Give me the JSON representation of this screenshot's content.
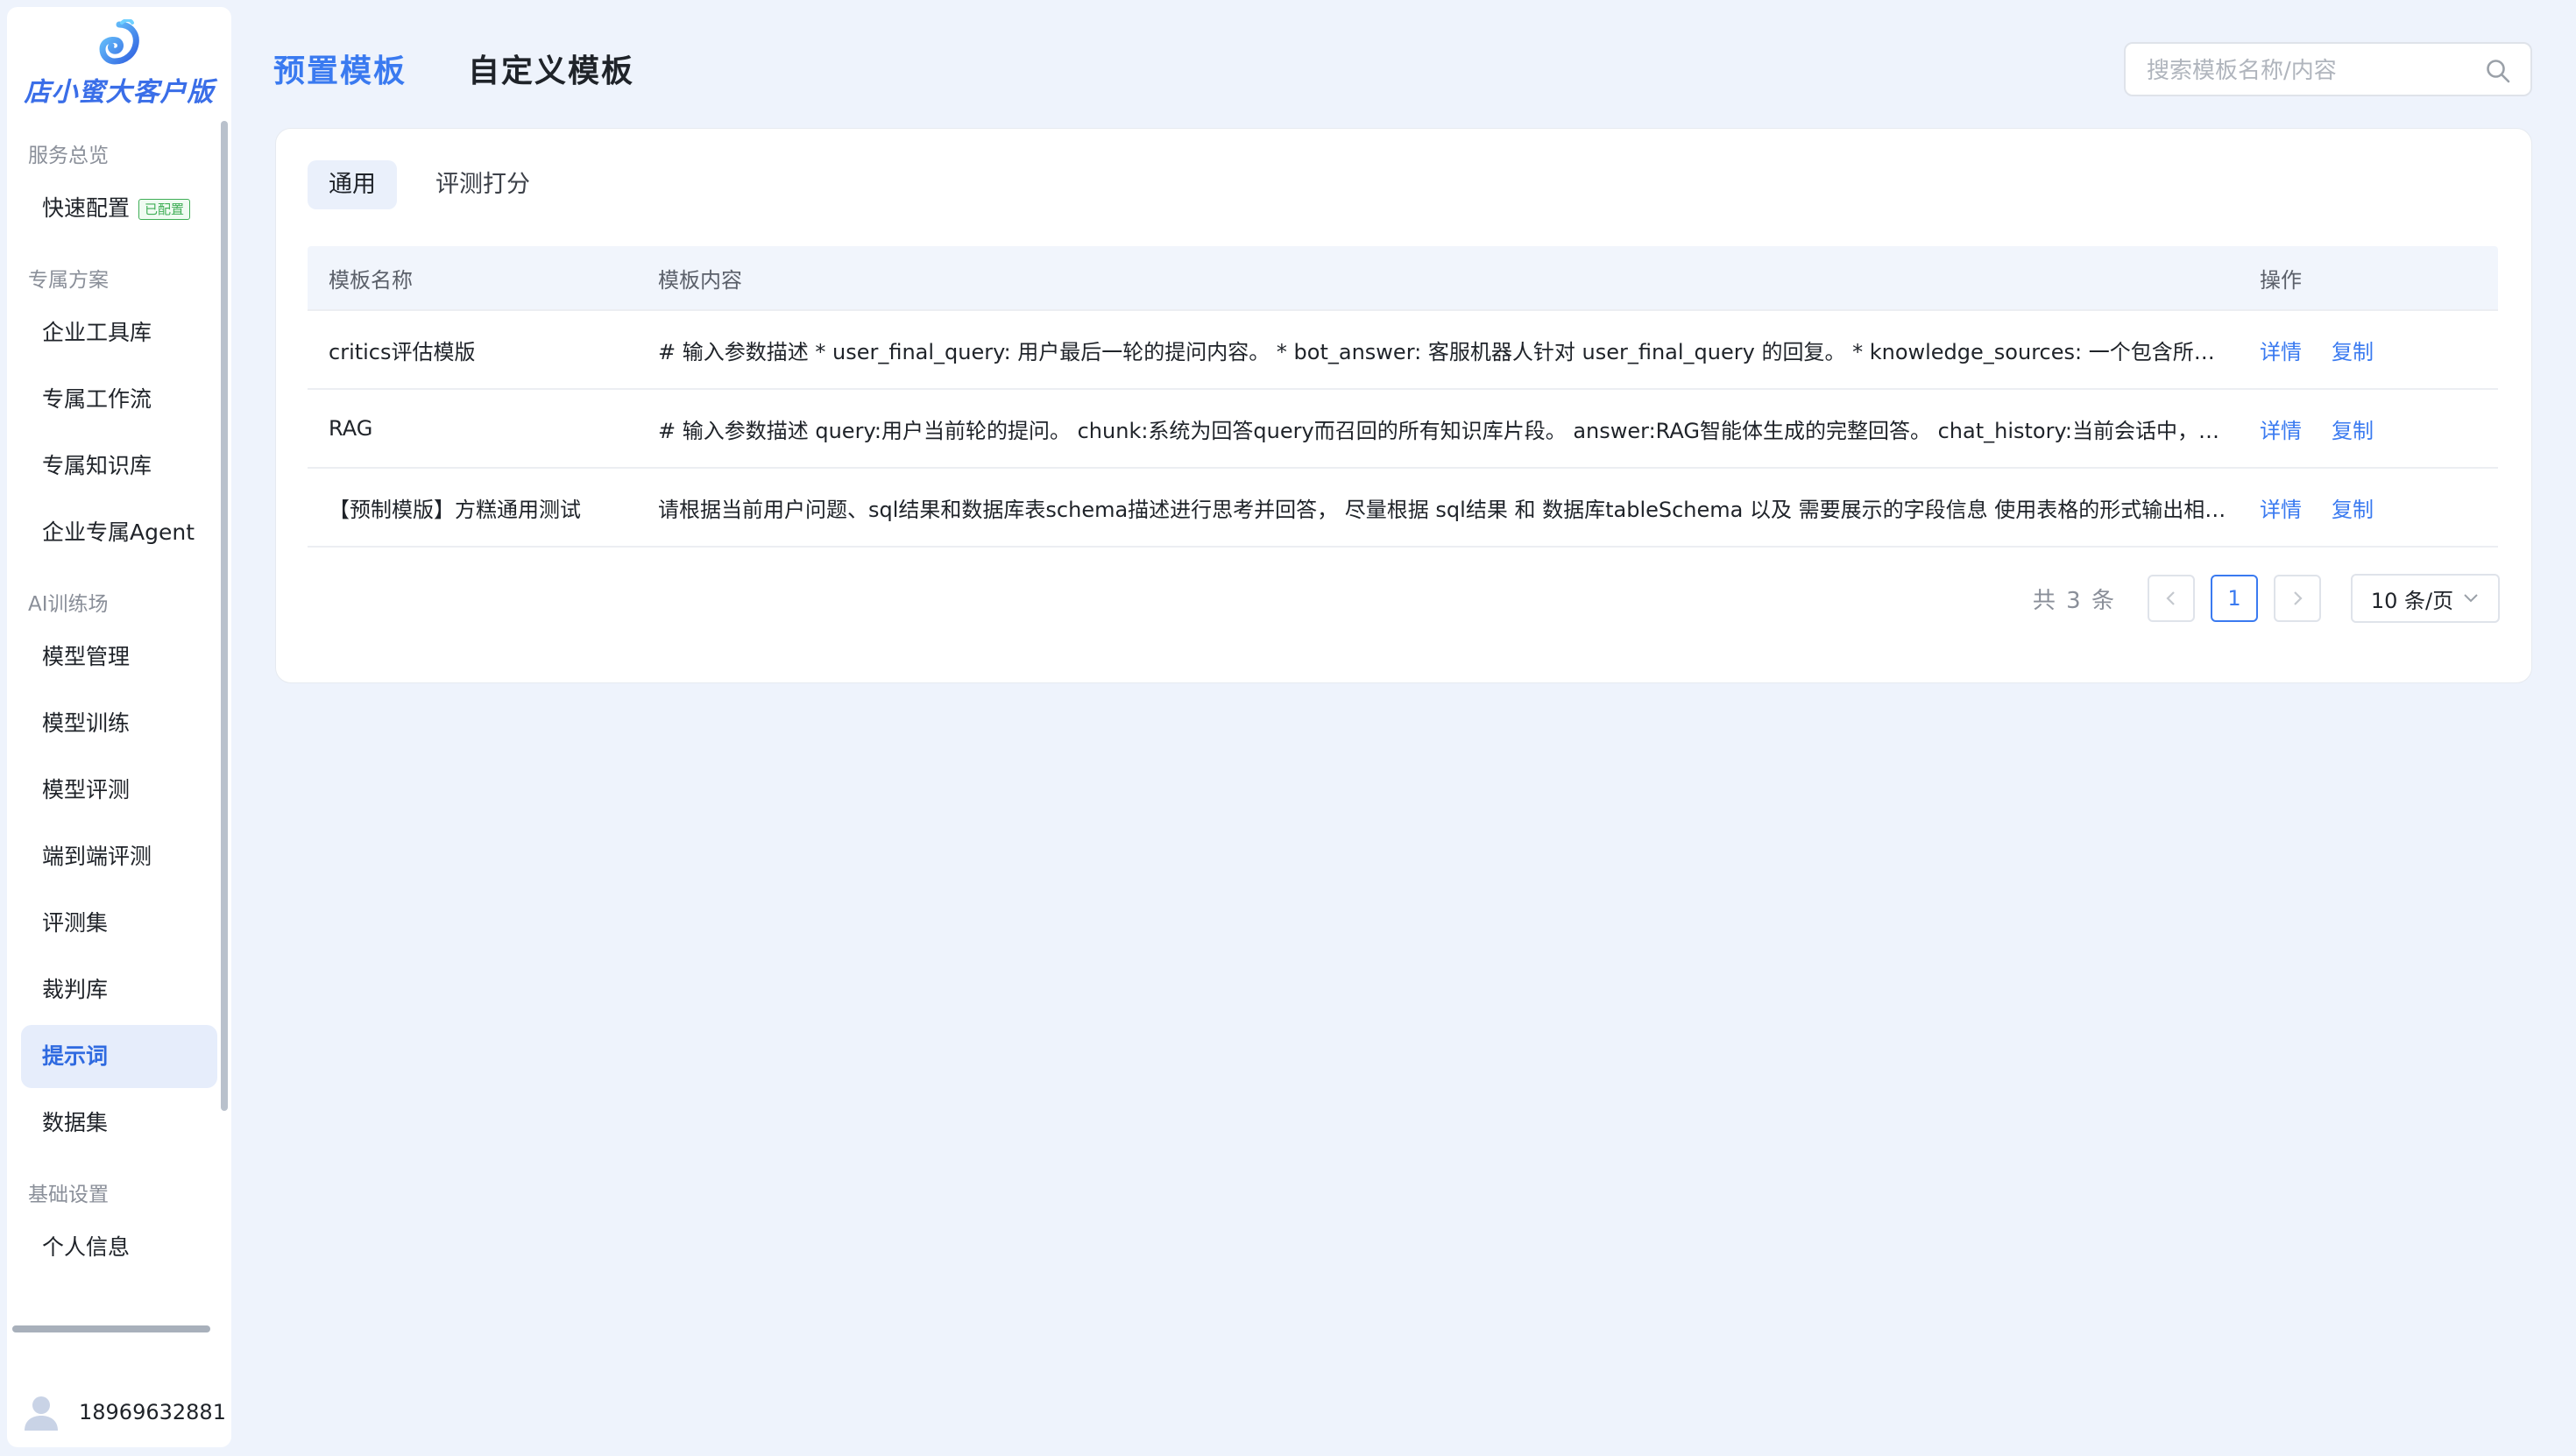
{
  "app": {
    "logo_text": "店小蜜大客户版"
  },
  "sidebar": {
    "sections": [
      {
        "title": "服务总览",
        "items": [
          {
            "label": "快速配置",
            "badge": "已配置"
          }
        ]
      },
      {
        "title": "专属方案",
        "items": [
          {
            "label": "企业工具库"
          },
          {
            "label": "专属工作流"
          },
          {
            "label": "专属知识库"
          },
          {
            "label": "企业专属Agent"
          }
        ]
      },
      {
        "title": "AI训练场",
        "items": [
          {
            "label": "模型管理"
          },
          {
            "label": "模型训练"
          },
          {
            "label": "模型评测"
          },
          {
            "label": "端到端评测"
          },
          {
            "label": "评测集"
          },
          {
            "label": "裁判库"
          },
          {
            "label": "提示词",
            "active": true
          },
          {
            "label": "数据集"
          }
        ]
      },
      {
        "title": "基础设置",
        "items": [
          {
            "label": "个人信息"
          }
        ]
      }
    ],
    "user": {
      "phone": "18969632881"
    }
  },
  "header": {
    "tabs": [
      {
        "label": "预置模板",
        "active": true
      },
      {
        "label": "自定义模板",
        "active": false
      }
    ],
    "search_placeholder": "搜索模板名称/内容"
  },
  "subtabs": [
    {
      "label": "通用",
      "active": true
    },
    {
      "label": "评测打分",
      "active": false
    }
  ],
  "table": {
    "columns": [
      "模板名称",
      "模板内容",
      "操作"
    ],
    "rows": [
      {
        "name": "critics评估模版",
        "content": "# 输入参数描述 * user_final_query: 用户最后一轮的提问内容。 * bot_answer: 客服机器人针对 user_final_query 的回复。 * knowledge_sources: 一个包含所有可用...",
        "detail": "详情",
        "copy": "复制"
      },
      {
        "name": "RAG",
        "content": "# 输入参数描述 query:用户当前轮的提问。 chunk:系统为回答query而召回的所有知识库片段。 answer:RAG智能体生成的完整回答。 chat_history:当前会话中，query...",
        "detail": "详情",
        "copy": "复制"
      },
      {
        "name": "【预制模版】方糕通用测试",
        "content": "请根据当前用户问题、sql结果和数据库表schema描述进行思考并回答， 尽量根据 sql结果 和 数据库tableSchema 以及 需要展示的字段信息 使用表格的形式输出相应的...",
        "detail": "详情",
        "copy": "复制"
      }
    ]
  },
  "pagination": {
    "total": "共 3 条",
    "current_page": "1",
    "page_size": "10 条/页"
  },
  "colors": {
    "accent": "#3a7af0",
    "page_bg": "#eef3fc",
    "success_badge": "#3fae56"
  }
}
